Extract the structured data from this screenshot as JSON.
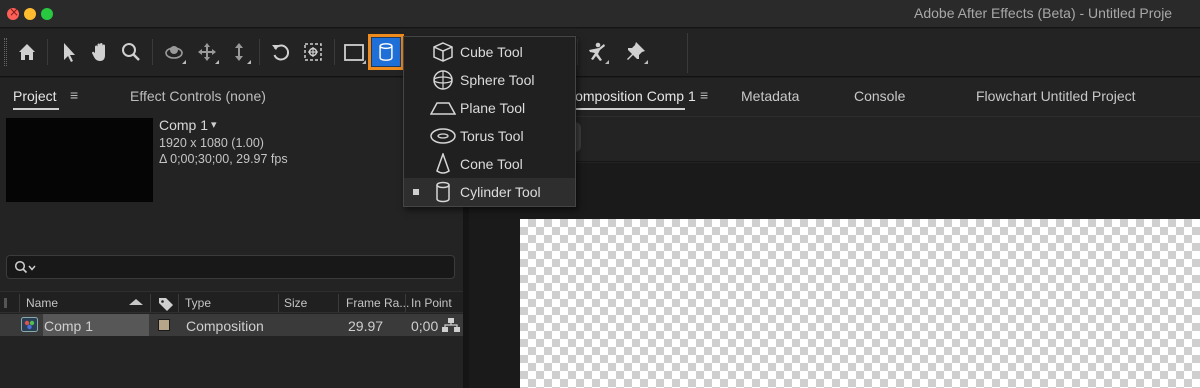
{
  "window": {
    "title": "Adobe After Effects (Beta) - Untitled Proje"
  },
  "colors": {
    "accent_highlight": "#ef8a1d",
    "active_tool_bg": "#1f6fd8",
    "comp_label": "#b7a58a"
  },
  "toolbar": {
    "tools": [
      "home-icon",
      "selection-arrow-icon",
      "hand-icon",
      "zoom-icon",
      "orbit-icon",
      "pan-icon",
      "dolly-icon",
      "rotate-icon",
      "anchor-icon",
      "rectangle-icon",
      "cylinder-icon",
      "puppet-icon",
      "pin-icon"
    ],
    "active_tool": "cylinder-icon"
  },
  "tool_menu": {
    "items": [
      {
        "label": "Cube Tool",
        "icon": "cube-icon",
        "selected": false
      },
      {
        "label": "Sphere Tool",
        "icon": "sphere-icon",
        "selected": false
      },
      {
        "label": "Plane Tool",
        "icon": "plane-icon",
        "selected": false
      },
      {
        "label": "Torus Tool",
        "icon": "torus-icon",
        "selected": false
      },
      {
        "label": "Cone Tool",
        "icon": "cone-icon",
        "selected": false
      },
      {
        "label": "Cylinder Tool",
        "icon": "cylinder-icon",
        "selected": true
      }
    ]
  },
  "project_panel": {
    "tab_project": "Project",
    "tab_menu": "≡",
    "tab_effect_controls": "Effect Controls (none)",
    "comp_name": "Comp 1",
    "comp_name_arrow": "▾",
    "comp_resolution": "1920 x 1080 (1.00)",
    "comp_duration": "Δ 0;00;30;00, 29.97 fps",
    "search_value": "",
    "columns": {
      "name": "Name",
      "type": "Type",
      "size": "Size",
      "frame_rate": "Frame Ra...",
      "in_point": "In Point"
    },
    "rows": [
      {
        "name": "Comp 1",
        "type": "Composition",
        "size": "",
        "frame_rate": "29.97",
        "in_point": "0;00"
      }
    ]
  },
  "comp_panel": {
    "tab_comp": "Composition Comp 1",
    "tab_menu": "≡",
    "tab_metadata": "Metadata",
    "tab_console": "Console",
    "tab_flowchart": "Flowchart Untitled Project"
  }
}
